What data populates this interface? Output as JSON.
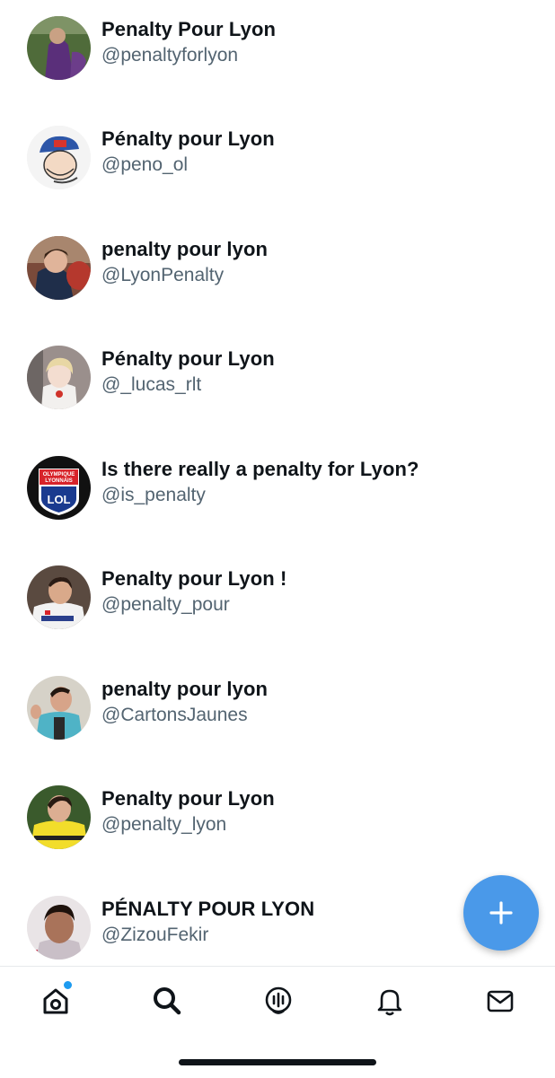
{
  "accounts": [
    {
      "name": "Penalty Pour Lyon",
      "handle": "@penaltyforlyon"
    },
    {
      "name": "Pénalty pour Lyon",
      "handle": "@peno_ol"
    },
    {
      "name": "penalty pour lyon",
      "handle": "@LyonPenalty"
    },
    {
      "name": "Pénalty pour Lyon",
      "handle": "@_lucas_rlt"
    },
    {
      "name": "Is there really a penalty for Lyon?",
      "handle": "@is_penalty"
    },
    {
      "name": "Penalty pour Lyon !",
      "handle": "@penalty_pour"
    },
    {
      "name": "penalty pour lyon",
      "handle": "@CartonsJaunes"
    },
    {
      "name": "Penalty pour Lyon",
      "handle": "@penalty_lyon"
    },
    {
      "name": "PÉNALTY POUR LYON",
      "handle": "@ZizouFekir"
    }
  ],
  "logo_text": [
    "OLYMPIQUE",
    "LYONNAIS",
    "LOL"
  ],
  "colors": {
    "accent": "#4a99e9",
    "handle_text": "#536471",
    "name_text": "#0f1419",
    "notification_dot": "#1d9bf0"
  },
  "fab": {
    "icon": "plus-icon"
  },
  "tabbar": {
    "tabs": [
      {
        "icon": "home-icon",
        "has_notification_dot": true
      },
      {
        "icon": "search-icon"
      },
      {
        "icon": "spaces-icon"
      },
      {
        "icon": "bell-icon"
      },
      {
        "icon": "mail-icon"
      }
    ]
  }
}
